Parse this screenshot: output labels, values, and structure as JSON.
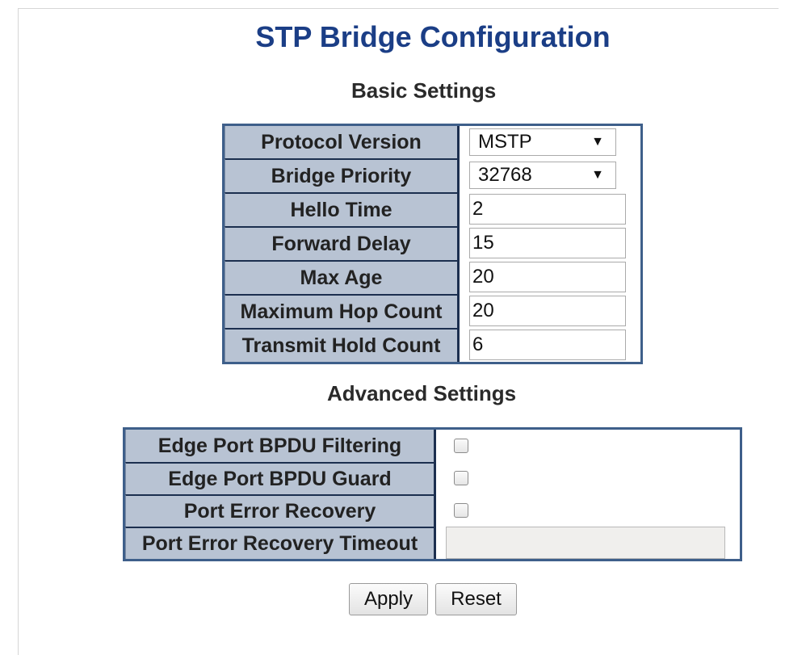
{
  "page": {
    "title": "STP Bridge Configuration",
    "title_color": "#1b3e86"
  },
  "basic": {
    "heading": "Basic Settings",
    "protocol_version": {
      "label": "Protocol Version",
      "value": "MSTP"
    },
    "bridge_priority": {
      "label": "Bridge Priority",
      "value": "32768"
    },
    "hello_time": {
      "label": "Hello Time",
      "value": "2"
    },
    "forward_delay": {
      "label": "Forward Delay",
      "value": "15"
    },
    "max_age": {
      "label": "Max Age",
      "value": "20"
    },
    "max_hop_count": {
      "label": "Maximum Hop Count",
      "value": "20"
    },
    "transmit_hold_count": {
      "label": "Transmit Hold Count",
      "value": "6"
    }
  },
  "advanced": {
    "heading": "Advanced Settings",
    "edge_bpdu_filtering": {
      "label": "Edge Port BPDU Filtering",
      "checked": false
    },
    "edge_bpdu_guard": {
      "label": "Edge Port BPDU Guard",
      "checked": false
    },
    "port_error_recovery": {
      "label": "Port Error Recovery",
      "checked": false
    },
    "port_error_recovery_timeout": {
      "label": "Port Error Recovery Timeout",
      "value": "",
      "disabled": true
    }
  },
  "buttons": {
    "apply": "Apply",
    "reset": "Reset"
  },
  "colors": {
    "label_bg": "#b8c3d3",
    "table_border": "#3e5f8a"
  }
}
